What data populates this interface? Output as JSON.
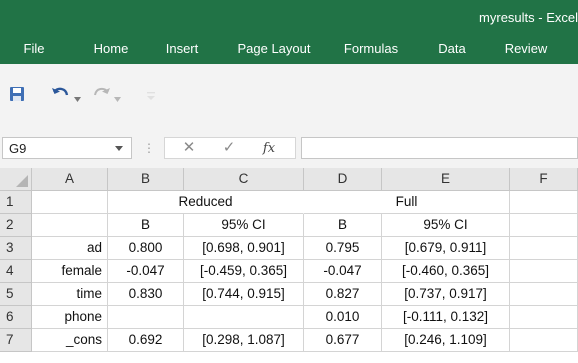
{
  "window": {
    "title": "myresults - Excel"
  },
  "ribbon": {
    "tabs": [
      "File",
      "Home",
      "Insert",
      "Page Layout",
      "Formulas",
      "Data",
      "Review"
    ]
  },
  "quick_access": {
    "icons": [
      "save-icon",
      "undo-icon",
      "redo-icon"
    ]
  },
  "formula_bar": {
    "name_box": "G9",
    "fx_label": "fx",
    "formula": ""
  },
  "colors": {
    "accent": "#217346",
    "header_bg": "#e6e6e6",
    "gridline": "#d4d4d4"
  },
  "sheet": {
    "columns": [
      "A",
      "B",
      "C",
      "D",
      "E",
      "F"
    ],
    "rows": [
      "1",
      "2",
      "3",
      "4",
      "5",
      "6",
      "7"
    ],
    "group_headers": {
      "reduced": "Reduced",
      "full": "Full"
    },
    "sub_headers": {
      "b1": "B",
      "ci1": "95% CI",
      "b2": "B",
      "ci2": "95% CI"
    },
    "data": [
      {
        "var": "ad",
        "b1": "0.800",
        "ci1": "[0.698, 0.901]",
        "b2": "0.795",
        "ci2": "[0.679, 0.911]"
      },
      {
        "var": "female",
        "b1": "-0.047",
        "ci1": "[-0.459, 0.365]",
        "b2": "-0.047",
        "ci2": "[-0.460, 0.365]"
      },
      {
        "var": "time",
        "b1": "0.830",
        "ci1": "[0.744, 0.915]",
        "b2": "0.827",
        "ci2": "[0.737, 0.917]"
      },
      {
        "var": "phone",
        "b1": "",
        "ci1": "",
        "b2": "0.010",
        "ci2": "[-0.111, 0.132]"
      },
      {
        "var": "_cons",
        "b1": "0.692",
        "ci1": "[0.298, 1.087]",
        "b2": "0.677",
        "ci2": "[0.246, 1.109]"
      }
    ]
  }
}
